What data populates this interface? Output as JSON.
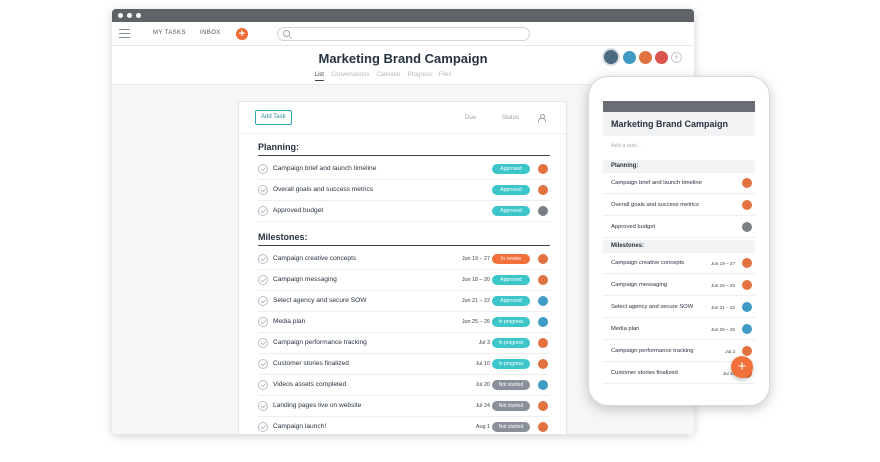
{
  "nav": {
    "my_tasks": "MY TASKS",
    "inbox": "INBOX",
    "add_symbol": "+"
  },
  "project": {
    "title": "Marketing Brand Campaign",
    "tabs": [
      "List",
      "Conversations",
      "Calendar",
      "Progress",
      "Files"
    ],
    "active_tab": "List",
    "member_colors": [
      "#4a6a82",
      "#3d9bc4",
      "#e0733f",
      "#d9554f"
    ],
    "add_member_symbol": "+"
  },
  "list": {
    "add_task_label": "Add Task",
    "col_due": "Due",
    "col_status": "Status",
    "sections": [
      {
        "title": "Planning:",
        "tasks": [
          {
            "name": "Campaign brief and launch timeline",
            "date": "",
            "status": "Approved",
            "status_color": "#3cc6c9",
            "avatar_color": "#e0733f"
          },
          {
            "name": "Overall goals and success metrics",
            "date": "",
            "status": "Approved",
            "status_color": "#3cc6c9",
            "avatar_color": "#e0733f"
          },
          {
            "name": "Approved budget",
            "date": "",
            "status": "Approved",
            "status_color": "#3cc6c9",
            "avatar_color": "#7a7f86"
          }
        ]
      },
      {
        "title": "Milestones:",
        "tasks": [
          {
            "name": "Campaign creative concepts",
            "date": "Jun 19 – 27",
            "status": "In review",
            "status_color": "#f27039",
            "avatar_color": "#e0733f"
          },
          {
            "name": "Campaign messaging",
            "date": "Jun 18 – 20",
            "status": "Approved",
            "status_color": "#3cc6c9",
            "avatar_color": "#e0733f"
          },
          {
            "name": "Select agency and secure SOW",
            "date": "Jun 21 – 22",
            "status": "Approved",
            "status_color": "#3cc6c9",
            "avatar_color": "#3d9bc4"
          },
          {
            "name": "Media plan",
            "date": "Jun 25 – 26",
            "status": "In progress",
            "status_color": "#3cc6c9",
            "avatar_color": "#3d9bc4"
          },
          {
            "name": "Campaign performance tracking",
            "date": "Jul 3",
            "status": "In progress",
            "status_color": "#3cc6c9",
            "avatar_color": "#e0733f"
          },
          {
            "name": "Customer stories finalized",
            "date": "Jul 10",
            "status": "In progress",
            "status_color": "#3cc6c9",
            "avatar_color": "#e0733f"
          },
          {
            "name": "Videos assets completed",
            "date": "Jul 20",
            "status": "Not started",
            "status_color": "#8a9099",
            "avatar_color": "#3d9bc4"
          },
          {
            "name": "Landing pages live on website",
            "date": "Jul 24",
            "status": "Not started",
            "status_color": "#8a9099",
            "avatar_color": "#e0733f"
          },
          {
            "name": "Campaign launch!",
            "date": "Aug 1",
            "status": "Not started",
            "status_color": "#8a9099",
            "avatar_color": "#e0733f"
          }
        ]
      }
    ]
  },
  "mobile": {
    "title": "Marketing Brand Campaign",
    "add_placeholder": "Add a task...",
    "planning_title": "Planning:",
    "milestones_title": "Milestones:",
    "planning": [
      {
        "name": "Campaign brief and launch timeline",
        "date": "",
        "avatar_color": "#e0733f"
      },
      {
        "name": "Overall goals and success metrics",
        "date": "",
        "avatar_color": "#e0733f"
      },
      {
        "name": "Approved budget",
        "date": "",
        "avatar_color": "#7a7f86"
      }
    ],
    "milestones": [
      {
        "name": "Campaign creative concepts",
        "date": "Jun 19 – 27",
        "avatar_color": "#e0733f"
      },
      {
        "name": "Campaign messaging",
        "date": "Jun 18 – 20",
        "avatar_color": "#e0733f"
      },
      {
        "name": "Select agency and secure SOW",
        "date": "Jun 21 – 22",
        "avatar_color": "#3d9bc4"
      },
      {
        "name": "Media plan",
        "date": "Jun 25 – 26",
        "avatar_color": "#3d9bc4"
      },
      {
        "name": "Campaign performance tracking",
        "date": "Jul 3",
        "avatar_color": "#e0733f"
      },
      {
        "name": "Customer stories finalized",
        "date": "Jul 10",
        "avatar_color": "#e0733f"
      }
    ],
    "fab_symbol": "+"
  },
  "colors": {
    "accent": "#f06a35",
    "teal": "#3cc6c9",
    "gray_pill": "#8a9099"
  }
}
